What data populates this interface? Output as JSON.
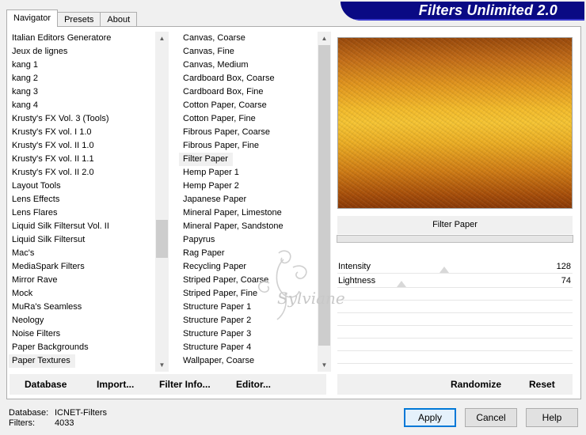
{
  "app": {
    "title": "Filters Unlimited 2.0"
  },
  "tabs": [
    {
      "label": "Navigator",
      "active": true
    },
    {
      "label": "Presets",
      "active": false
    },
    {
      "label": "About",
      "active": false
    }
  ],
  "categories": {
    "items": [
      "Italian Editors Generatore",
      "Jeux de lignes",
      "kang 1",
      "kang 2",
      "kang 3",
      "kang 4",
      "Krusty's FX Vol. 3 (Tools)",
      "Krusty's FX vol. I 1.0",
      "Krusty's FX vol. II 1.0",
      "Krusty's FX vol. II 1.1",
      "Krusty's FX vol. II 2.0",
      "Layout Tools",
      "Lens Effects",
      "Lens Flares",
      "Liquid Silk Filtersut Vol. II",
      "Liquid Silk Filtersut",
      "Mac's",
      "MediaSpark Filters",
      "Mirror Rave",
      "Mock",
      "MuRa's Seamless",
      "Neology",
      "Noise Filters",
      "Paper Backgrounds",
      "Paper Textures"
    ],
    "selected": "Paper Textures"
  },
  "filters": {
    "items": [
      "Canvas, Coarse",
      "Canvas, Fine",
      "Canvas, Medium",
      "Cardboard Box, Coarse",
      "Cardboard Box, Fine",
      "Cotton Paper, Coarse",
      "Cotton Paper, Fine",
      "Fibrous Paper, Coarse",
      "Fibrous Paper, Fine",
      "Filter Paper",
      "Hemp Paper 1",
      "Hemp Paper 2",
      "Japanese Paper",
      "Mineral Paper, Limestone",
      "Mineral Paper, Sandstone",
      "Papyrus",
      "Rag Paper",
      "Recycling Paper",
      "Striped Paper, Coarse",
      "Striped Paper, Fine",
      "Structure Paper 1",
      "Structure Paper 2",
      "Structure Paper 3",
      "Structure Paper 4",
      "Wallpaper, Coarse"
    ],
    "selected": "Filter Paper"
  },
  "preview": {
    "filter_name": "Filter Paper"
  },
  "sliders": [
    {
      "label": "Intensity",
      "value": "128",
      "fraction": 0.502
    },
    {
      "label": "Lightness",
      "value": "74",
      "fraction": 0.29
    }
  ],
  "toolbar": {
    "database_label": "Database",
    "import_label": "Import...",
    "filter_info_label": "Filter Info...",
    "editor_label": "Editor...",
    "randomize_label": "Randomize",
    "reset_label": "Reset"
  },
  "status": {
    "database_key": "Database:",
    "database_value": "ICNET-Filters",
    "filters_key": "Filters:",
    "filters_value": "4033"
  },
  "buttons": {
    "apply_label": "Apply",
    "cancel_label": "Cancel",
    "help_label": "Help"
  },
  "colors": {
    "banner": "#0a0a84",
    "selection": "#f0f0f0",
    "default_button_border": "#0078d7"
  }
}
